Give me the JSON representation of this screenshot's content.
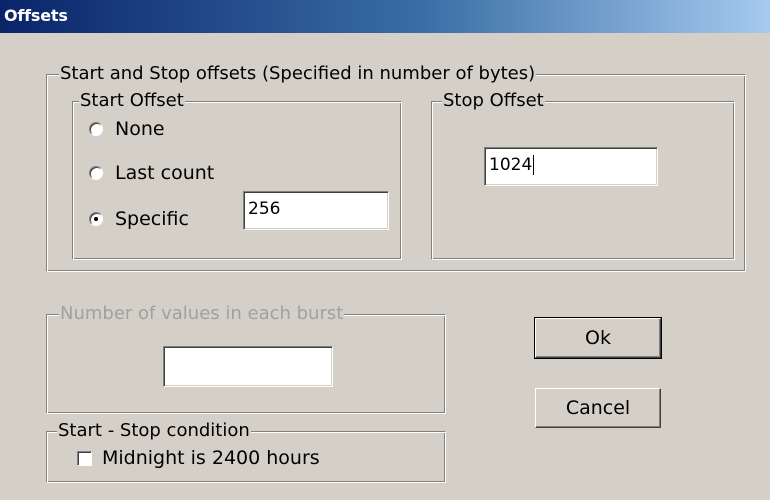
{
  "window": {
    "title": "Offsets"
  },
  "offsets_group": {
    "legend": "Start and Stop offsets (Specified in number of bytes)",
    "start_offset": {
      "legend": "Start Offset",
      "options": [
        {
          "label": "None",
          "checked": false
        },
        {
          "label": "Last count",
          "checked": false
        },
        {
          "label": "Specific",
          "checked": true
        }
      ],
      "specific_value": "256"
    },
    "stop_offset": {
      "legend": "Stop Offset",
      "value": "1024"
    }
  },
  "burst_group": {
    "legend": "Number of values in each burst",
    "value": "",
    "enabled": false
  },
  "condition_group": {
    "legend": "Start - Stop condition",
    "checkbox_label": "Midnight is 2400 hours",
    "checked": false
  },
  "buttons": {
    "ok": "Ok",
    "cancel": "Cancel"
  }
}
